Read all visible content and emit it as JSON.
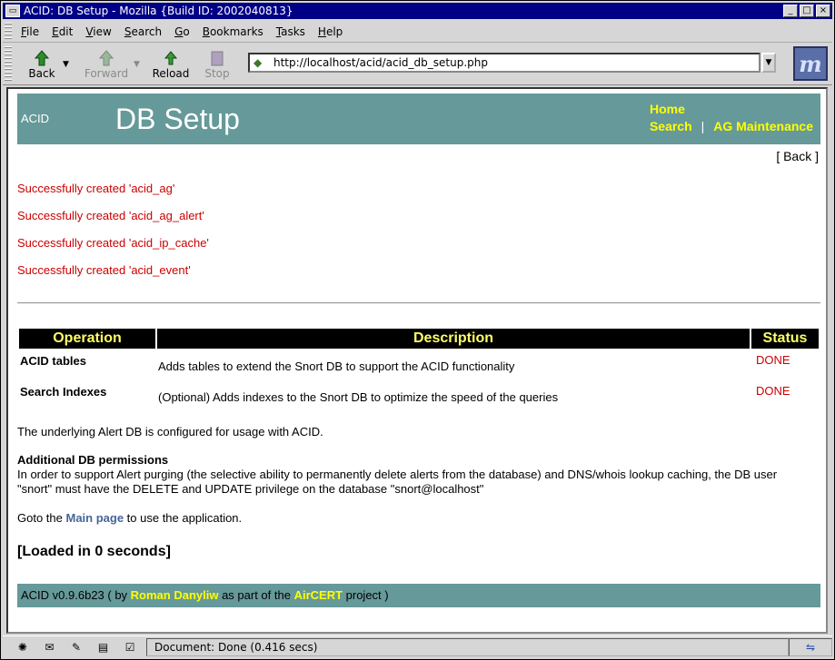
{
  "window": {
    "title": "ACID: DB Setup - Mozilla {Build ID: 2002040813}"
  },
  "menubar": {
    "items": [
      {
        "label": "File",
        "ul": "F",
        "rest": "ile"
      },
      {
        "label": "Edit",
        "ul": "E",
        "rest": "dit"
      },
      {
        "label": "View",
        "ul": "V",
        "rest": "iew"
      },
      {
        "label": "Search",
        "ul": "S",
        "rest": "earch"
      },
      {
        "label": "Go",
        "ul": "G",
        "rest": "o"
      },
      {
        "label": "Bookmarks",
        "ul": "B",
        "rest": "ookmarks"
      },
      {
        "label": "Tasks",
        "ul": "T",
        "rest": "asks"
      },
      {
        "label": "Help",
        "ul": "H",
        "rest": "elp"
      }
    ]
  },
  "toolbar": {
    "back": "Back",
    "forward": "Forward",
    "reload": "Reload",
    "stop": "Stop",
    "url": "http://localhost/acid/acid_db_setup.php"
  },
  "page": {
    "header": {
      "app": "ACID",
      "title": "DB Setup",
      "nav_home": "Home",
      "nav_search": "Search",
      "nav_sep": "|",
      "nav_ag": "AG Maintenance"
    },
    "back_link": "[ Back ]",
    "messages": [
      "Successfully created 'acid_ag'",
      "Successfully created 'acid_ag_alert'",
      "Successfully created 'acid_ip_cache'",
      "Successfully created 'acid_event'"
    ],
    "table": {
      "headers": {
        "operation": "Operation",
        "description": "Description",
        "status": "Status"
      },
      "rows": [
        {
          "operation": "ACID tables",
          "description": "Adds tables to extend the Snort DB to support the ACID functionality",
          "status": "DONE"
        },
        {
          "operation": "Search Indexes",
          "description": "(Optional) Adds indexes to the Snort DB to optimize the speed of the queries",
          "status": "DONE"
        }
      ]
    },
    "configured": "The underlying Alert DB is configured for usage with ACID.",
    "perm_title": "Additional DB permissions",
    "perm_line1": "In order to support Alert purging (the selective ability to permanently delete alerts from the database) and DNS/whois lookup caching, the DB user",
    "perm_line2": "\"snort\" must have the DELETE and UPDATE privilege on the database \"snort@localhost\"",
    "goto_pre": "Goto the ",
    "goto_link": "Main page",
    "goto_post": " to use the application.",
    "loaded": "[Loaded in 0 seconds]",
    "footer": {
      "pre": "ACID v0.9.6b23 ( by ",
      "author": "Roman Danyliw",
      "mid": " as part of the ",
      "aircert": "AirCERT",
      "post": " project )"
    }
  },
  "statusbar": {
    "text": "Document: Done (0.416 secs)"
  },
  "colors": {
    "header_bg": "#669999",
    "nav_yellow": "#ffff00",
    "success_red": "#cc0000",
    "title_bar": "#000086"
  },
  "icons": [
    "back-icon",
    "forward-icon",
    "reload-icon",
    "stop-icon",
    "site-icon",
    "mozilla-throbber-icon"
  ]
}
